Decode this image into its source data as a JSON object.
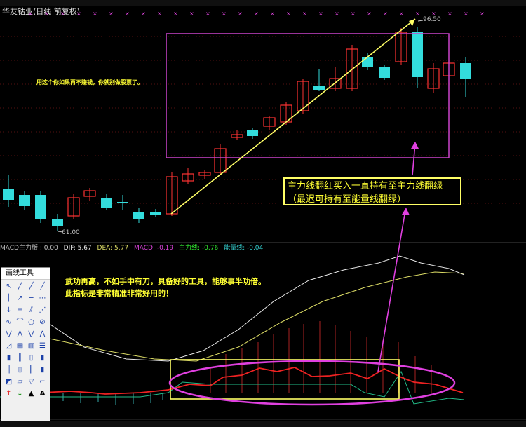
{
  "window": {
    "stock_title": "华友钴业(日线 前复权)"
  },
  "annotations": {
    "top_note": "用这个你如果再不赚钱，你就别做股票了。",
    "callout_text": "主力线翻红买入一直持有至主力线翻绿（最迟可持有至能量线翻绿）",
    "lower_note_line1": "武功再高，不如手中有刀，具备好的工具，能够事半功倍。",
    "lower_note_line2": "此指标是非常精准非常好用的！"
  },
  "price_labels": {
    "high": "96.50",
    "low": "61.00"
  },
  "indicator": {
    "name": "MACD主力版 : 0.00",
    "dif": "DIF: 5.67",
    "dea": "DEA: 5.77",
    "macd": "MACD: -0.19",
    "main_line": "主力线: -0.76",
    "energy_line": "能量线: -0.04"
  },
  "toolbox": {
    "title": "画线工具",
    "tools": [
      {
        "icon": "arrow-up-left",
        "glyph": "↖"
      },
      {
        "icon": "line-diagonal",
        "glyph": "╱"
      },
      {
        "icon": "line-diagonal-2",
        "glyph": "╱"
      },
      {
        "icon": "line-diagonal-3",
        "glyph": "╱"
      },
      {
        "icon": "vertical-line",
        "glyph": "│"
      },
      {
        "icon": "segment-arrow",
        "glyph": "↗"
      },
      {
        "icon": "horizontal-line",
        "glyph": "─"
      },
      {
        "icon": "segment-dots",
        "glyph": "⋯"
      },
      {
        "icon": "ray-down",
        "glyph": "↓"
      },
      {
        "icon": "parallel-lines",
        "glyph": "≡"
      },
      {
        "icon": "channel",
        "glyph": "⫽"
      },
      {
        "icon": "fan",
        "glyph": "⋰"
      },
      {
        "icon": "wave",
        "glyph": "∿"
      },
      {
        "icon": "curve",
        "glyph": "⌒"
      },
      {
        "icon": "circle",
        "glyph": "○"
      },
      {
        "icon": "crossed-circle",
        "glyph": "⊘"
      },
      {
        "icon": "zigzag",
        "glyph": "⋁"
      },
      {
        "icon": "zigzag-2",
        "glyph": "⋀"
      },
      {
        "icon": "zigzag-3",
        "glyph": "⋁"
      },
      {
        "icon": "zigzag-4",
        "glyph": "⋀"
      },
      {
        "icon": "triangle-pattern",
        "glyph": "◿"
      },
      {
        "icon": "gann-box",
        "glyph": "▤"
      },
      {
        "icon": "gann-grid",
        "glyph": "▥"
      },
      {
        "icon": "fib-lines",
        "glyph": "☰"
      },
      {
        "icon": "bars-1",
        "glyph": "▮"
      },
      {
        "icon": "bars-2",
        "glyph": "║"
      },
      {
        "icon": "bars-3",
        "glyph": "▯"
      },
      {
        "icon": "bars-4",
        "glyph": "▮"
      },
      {
        "icon": "bars-5",
        "glyph": "║"
      },
      {
        "icon": "bars-6",
        "glyph": "▯"
      },
      {
        "icon": "bars-7",
        "glyph": "║"
      },
      {
        "icon": "bars-8",
        "glyph": "▮"
      },
      {
        "icon": "rect",
        "glyph": "◩"
      },
      {
        "icon": "rect-2",
        "glyph": "▱"
      },
      {
        "icon": "triangle-down",
        "glyph": "▽"
      },
      {
        "icon": "frame",
        "glyph": "⌐"
      },
      {
        "icon": "arrow-up",
        "glyph": "↑",
        "color": "red"
      },
      {
        "icon": "arrow-down",
        "glyph": "↓",
        "color": "green"
      },
      {
        "icon": "marker",
        "glyph": "▲",
        "color": "dark"
      },
      {
        "icon": "text",
        "glyph": "A",
        "color": "dark"
      }
    ]
  },
  "colors": {
    "up_candle": "#ff3333",
    "down_candle": "#33dddd",
    "box": "#cc44cc",
    "trend": "#ffff66",
    "ellipse": "#e040e0",
    "dif_line": "#e8e8e8",
    "dea_line": "#dddd66",
    "main_line": "#ee2222",
    "energy_line": "#33bbbb"
  }
}
